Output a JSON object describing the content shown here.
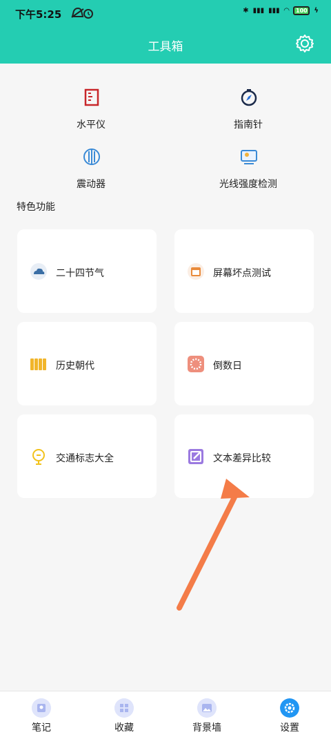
{
  "status": {
    "time": "下午5:25",
    "battery": "100"
  },
  "header": {
    "title": "工具箱"
  },
  "tools": [
    {
      "label": "水平仪",
      "icon": "spirit-level-icon"
    },
    {
      "label": "指南针",
      "icon": "compass-icon"
    },
    {
      "label": "震动器",
      "icon": "vibrator-icon"
    },
    {
      "label": "光线强度检测",
      "icon": "light-meter-icon"
    }
  ],
  "section": {
    "title": "特色功能"
  },
  "features": [
    {
      "label": "二十四节气",
      "icon": "cloud-icon"
    },
    {
      "label": "屏幕坏点测试",
      "icon": "calendar-icon"
    },
    {
      "label": "历史朝代",
      "icon": "scroll-icon"
    },
    {
      "label": "倒数日",
      "icon": "countdown-icon"
    },
    {
      "label": "交通标志大全",
      "icon": "traffic-sign-icon"
    },
    {
      "label": "文本差异比较",
      "icon": "edit-icon"
    }
  ],
  "tabs": [
    {
      "label": "笔记",
      "icon": "note-icon"
    },
    {
      "label": "收藏",
      "icon": "grid-icon"
    },
    {
      "label": "背景墙",
      "icon": "image-icon"
    },
    {
      "label": "设置",
      "icon": "settings-icon",
      "active": true
    }
  ],
  "colors": {
    "accent": "#24cdb2",
    "tab_active": "#2196f3",
    "annotation_arrow": "#f47c48"
  }
}
